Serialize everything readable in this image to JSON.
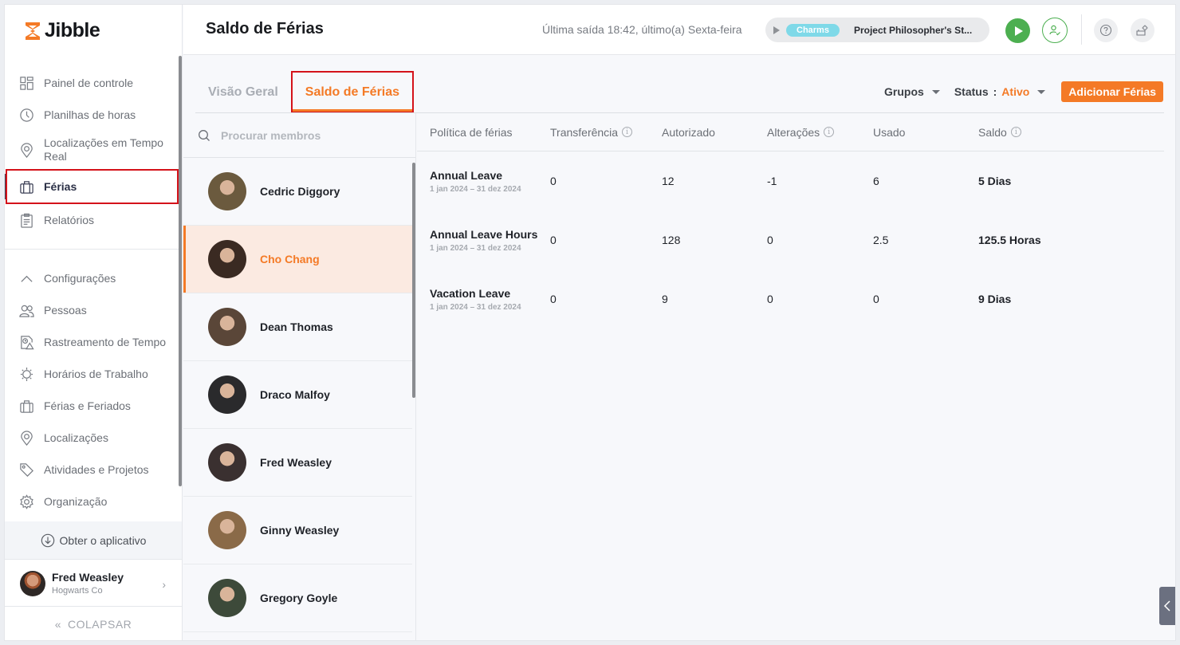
{
  "app": {
    "brand": "Jibble",
    "brand_color": "#f47a26",
    "accent_color": "#f47a26",
    "success_color": "#4caf50"
  },
  "sidebar": {
    "primary_items": [
      {
        "label": "Painel de controle",
        "icon": "dashboard-icon"
      },
      {
        "label": "Planilhas de horas",
        "icon": "clock-icon"
      },
      {
        "label": "Localizações em Tempo Real",
        "icon": "location-pin-icon"
      },
      {
        "label": "Férias",
        "icon": "briefcase-icon",
        "active": true
      },
      {
        "label": "Relatórios",
        "icon": "clipboard-icon"
      }
    ],
    "settings_items": [
      {
        "label": "Configurações",
        "icon": "chevron-up-icon"
      },
      {
        "label": "Pessoas",
        "icon": "people-icon"
      },
      {
        "label": "Rastreamento de Tempo",
        "icon": "time-tracking-icon"
      },
      {
        "label": "Horários de Trabalho",
        "icon": "work-schedule-icon"
      },
      {
        "label": "Férias e Feriados",
        "icon": "briefcase-icon"
      },
      {
        "label": "Localizações",
        "icon": "location-pin-icon"
      },
      {
        "label": "Atividades e Projetos",
        "icon": "tag-icon"
      },
      {
        "label": "Organização",
        "icon": "gear-icon"
      }
    ],
    "get_app_label": "Obter o aplicativo",
    "user": {
      "name": "Fred Weasley",
      "org": "Hogwarts Co"
    },
    "collapse_label": "COLAPSAR"
  },
  "header": {
    "title": "Saldo de Férias",
    "last_out": "Última saída 18:42, último(a) Sexta-feira",
    "timer": {
      "activity_tag": "Charms",
      "project": "Project Philosopher's St..."
    }
  },
  "tabs": [
    {
      "label": "Visão Geral",
      "active": false
    },
    {
      "label": "Saldo de Férias",
      "active": true
    }
  ],
  "filters": {
    "groups_label": "Grupos",
    "status_label": "Status",
    "status_value": "Ativo",
    "add_button": "Adicionar Férias"
  },
  "members": {
    "search_placeholder": "Procurar membros",
    "list": [
      {
        "name": "Cedric Diggory",
        "selected": false,
        "avatar_color": "#6b5a3e"
      },
      {
        "name": "Cho Chang",
        "selected": true,
        "avatar_color": "#3a2a22"
      },
      {
        "name": "Dean Thomas",
        "selected": false,
        "avatar_color": "#5a4638"
      },
      {
        "name": "Draco Malfoy",
        "selected": false,
        "avatar_color": "#2a2a2c"
      },
      {
        "name": "Fred Weasley",
        "selected": false,
        "avatar_color": "#3a3030"
      },
      {
        "name": "Ginny Weasley",
        "selected": false,
        "avatar_color": "#8a6a48"
      },
      {
        "name": "Gregory Goyle",
        "selected": false,
        "avatar_color": "#3d4a3a"
      }
    ]
  },
  "table": {
    "columns": [
      "Política de férias",
      "Transferência",
      "Autorizado",
      "Alterações",
      "Usado",
      "Saldo"
    ],
    "columns_with_info": [
      1,
      3,
      5
    ],
    "rows": [
      {
        "policy": "Annual Leave",
        "period": "1 jan 2024 – 31 dez 2024",
        "transfer": "0",
        "authorized": "12",
        "changes": "-1",
        "used": "6",
        "balance": "5 Dias"
      },
      {
        "policy": "Annual Leave Hours",
        "period": "1 jan 2024 – 31 dez 2024",
        "transfer": "0",
        "authorized": "128",
        "changes": "0",
        "used": "2.5",
        "balance": "125.5 Horas"
      },
      {
        "policy": "Vacation Leave",
        "period": "1 jan 2024 – 31 dez 2024",
        "transfer": "0",
        "authorized": "9",
        "changes": "0",
        "used": "0",
        "balance": "9 Dias"
      }
    ]
  }
}
